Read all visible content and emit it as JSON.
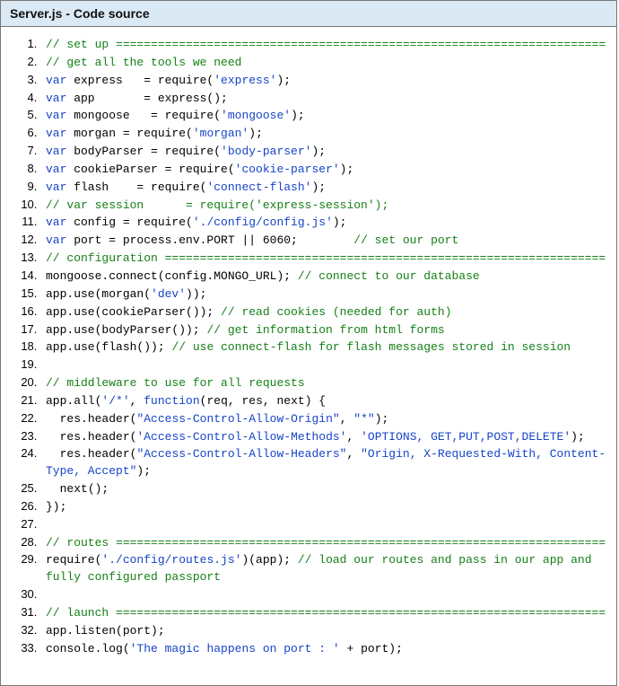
{
  "header": {
    "title": "Server.js - Code source"
  },
  "code": {
    "lines": [
      [
        {
          "cls": "tok-cm",
          "t": "// set up ======================================================================"
        }
      ],
      [
        {
          "cls": "tok-cm",
          "t": "// get all the tools we need"
        }
      ],
      [
        {
          "cls": "tok-kw",
          "t": "var"
        },
        {
          "cls": "tok-pl",
          "t": " express   = require("
        },
        {
          "cls": "tok-st",
          "t": "'express'"
        },
        {
          "cls": "tok-pl",
          "t": ");"
        }
      ],
      [
        {
          "cls": "tok-kw",
          "t": "var"
        },
        {
          "cls": "tok-pl",
          "t": " app       = express();"
        }
      ],
      [
        {
          "cls": "tok-kw",
          "t": "var"
        },
        {
          "cls": "tok-pl",
          "t": " mongoose   = require("
        },
        {
          "cls": "tok-st",
          "t": "'mongoose'"
        },
        {
          "cls": "tok-pl",
          "t": ");"
        }
      ],
      [
        {
          "cls": "tok-kw",
          "t": "var"
        },
        {
          "cls": "tok-pl",
          "t": " morgan = require("
        },
        {
          "cls": "tok-st",
          "t": "'morgan'"
        },
        {
          "cls": "tok-pl",
          "t": ");"
        }
      ],
      [
        {
          "cls": "tok-kw",
          "t": "var"
        },
        {
          "cls": "tok-pl",
          "t": " bodyParser = require("
        },
        {
          "cls": "tok-st",
          "t": "'body-parser'"
        },
        {
          "cls": "tok-pl",
          "t": ");"
        }
      ],
      [
        {
          "cls": "tok-kw",
          "t": "var"
        },
        {
          "cls": "tok-pl",
          "t": " cookieParser = require("
        },
        {
          "cls": "tok-st",
          "t": "'cookie-parser'"
        },
        {
          "cls": "tok-pl",
          "t": ");"
        }
      ],
      [
        {
          "cls": "tok-kw",
          "t": "var"
        },
        {
          "cls": "tok-pl",
          "t": " flash    = require("
        },
        {
          "cls": "tok-st",
          "t": "'connect-flash'"
        },
        {
          "cls": "tok-pl",
          "t": ");"
        }
      ],
      [
        {
          "cls": "tok-cm",
          "t": "// var session      = require('express-session');"
        }
      ],
      [
        {
          "cls": "tok-kw",
          "t": "var"
        },
        {
          "cls": "tok-pl",
          "t": " config = require("
        },
        {
          "cls": "tok-st",
          "t": "'./config/config.js'"
        },
        {
          "cls": "tok-pl",
          "t": ");"
        }
      ],
      [
        {
          "cls": "tok-kw",
          "t": "var"
        },
        {
          "cls": "tok-pl",
          "t": " port = process.env.PORT || 6060;        "
        },
        {
          "cls": "tok-cm",
          "t": "// set our port"
        }
      ],
      [
        {
          "cls": "tok-cm",
          "t": "// configuration ==============================================================="
        }
      ],
      [
        {
          "cls": "tok-pl",
          "t": "mongoose.connect(config.MONGO_URL); "
        },
        {
          "cls": "tok-cm",
          "t": "// connect to our database"
        }
      ],
      [
        {
          "cls": "tok-pl",
          "t": "app.use(morgan("
        },
        {
          "cls": "tok-st",
          "t": "'dev'"
        },
        {
          "cls": "tok-pl",
          "t": "));"
        }
      ],
      [
        {
          "cls": "tok-pl",
          "t": "app.use(cookieParser()); "
        },
        {
          "cls": "tok-cm",
          "t": "// read cookies (needed for auth)"
        }
      ],
      [
        {
          "cls": "tok-pl",
          "t": "app.use(bodyParser()); "
        },
        {
          "cls": "tok-cm",
          "t": "// get information from html forms"
        }
      ],
      [
        {
          "cls": "tok-pl",
          "t": "app.use(flash()); "
        },
        {
          "cls": "tok-cm",
          "t": "// use connect-flash for flash messages stored in session"
        }
      ],
      [
        {
          "cls": "tok-pl",
          "t": " "
        }
      ],
      [
        {
          "cls": "tok-cm",
          "t": "// middleware to use for all requests"
        }
      ],
      [
        {
          "cls": "tok-pl",
          "t": "app.all("
        },
        {
          "cls": "tok-st",
          "t": "'/*'"
        },
        {
          "cls": "tok-pl",
          "t": ", "
        },
        {
          "cls": "tok-kw",
          "t": "function"
        },
        {
          "cls": "tok-pl",
          "t": "(req, res, next) {"
        }
      ],
      [
        {
          "cls": "tok-pl",
          "t": "  res.header("
        },
        {
          "cls": "tok-st",
          "t": "\"Access-Control-Allow-Origin\""
        },
        {
          "cls": "tok-pl",
          "t": ", "
        },
        {
          "cls": "tok-st",
          "t": "\"*\""
        },
        {
          "cls": "tok-pl",
          "t": ");"
        }
      ],
      [
        {
          "cls": "tok-pl",
          "t": "  res.header("
        },
        {
          "cls": "tok-st",
          "t": "'Access-Control-Allow-Methods'"
        },
        {
          "cls": "tok-pl",
          "t": ", "
        },
        {
          "cls": "tok-st",
          "t": "'OPTIONS, GET,PUT,POST,DELETE'"
        },
        {
          "cls": "tok-pl",
          "t": ");"
        }
      ],
      [
        {
          "cls": "tok-pl",
          "t": "  res.header("
        },
        {
          "cls": "tok-st",
          "t": "\"Access-Control-Allow-Headers\""
        },
        {
          "cls": "tok-pl",
          "t": ", "
        },
        {
          "cls": "tok-st",
          "t": "\"Origin, X-Requested-With, Content-Type, Accept\""
        },
        {
          "cls": "tok-pl",
          "t": ");"
        }
      ],
      [
        {
          "cls": "tok-pl",
          "t": "  next();"
        }
      ],
      [
        {
          "cls": "tok-pl",
          "t": "});"
        }
      ],
      [
        {
          "cls": "tok-pl",
          "t": " "
        }
      ],
      [
        {
          "cls": "tok-cm",
          "t": "// routes ======================================================================"
        }
      ],
      [
        {
          "cls": "tok-pl",
          "t": "require("
        },
        {
          "cls": "tok-st",
          "t": "'./config/routes.js'"
        },
        {
          "cls": "tok-pl",
          "t": ")(app); "
        },
        {
          "cls": "tok-cm",
          "t": "// load our routes and pass in our app and fully configured passport"
        }
      ],
      [
        {
          "cls": "tok-pl",
          "t": " "
        }
      ],
      [
        {
          "cls": "tok-cm",
          "t": "// launch ======================================================================"
        }
      ],
      [
        {
          "cls": "tok-pl",
          "t": "app.listen(port);"
        }
      ],
      [
        {
          "cls": "tok-pl",
          "t": "console.log("
        },
        {
          "cls": "tok-st",
          "t": "'The magic happens on port : '"
        },
        {
          "cls": "tok-pl",
          "t": " + port);"
        }
      ]
    ]
  }
}
